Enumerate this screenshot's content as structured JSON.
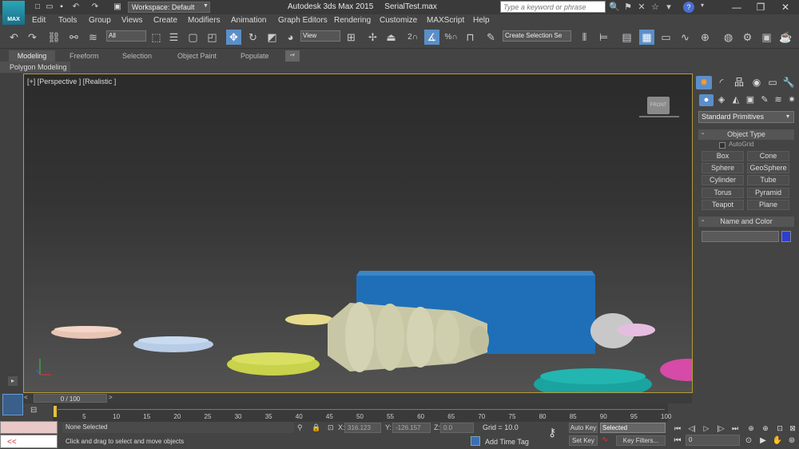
{
  "title": {
    "app": "Autodesk 3ds Max  2015",
    "file": "SerialTest.max",
    "workspace": "Workspace: Default",
    "search_placeholder": "Type a keyword or phrase",
    "logo": "MAX"
  },
  "menu": [
    "Edit",
    "Tools",
    "Group",
    "Views",
    "Create",
    "Modifiers",
    "Animation",
    "Graph Editors",
    "Rendering",
    "Customize",
    "MAXScript",
    "Help"
  ],
  "toolbar": {
    "filter": "All",
    "refcoord": "View",
    "selset": "Create Selection Se",
    "snap_label": "2",
    "angle_label": "%"
  },
  "ribbon": {
    "tabs": [
      "Modeling",
      "Freeform",
      "Selection",
      "Object Paint",
      "Populate"
    ],
    "panel": "Polygon Modeling"
  },
  "viewport": {
    "label": "[+] [Perspective ] [Realistic ]",
    "viewcube": "FRONT"
  },
  "command_panel": {
    "category": "Standard Primitives",
    "object_type_header": "Object Type",
    "autogrid": "AutoGrid",
    "buttons": [
      "Box",
      "Cone",
      "Sphere",
      "GeoSphere",
      "Cylinder",
      "Tube",
      "Torus",
      "Pyramid",
      "Teapot",
      "Plane"
    ],
    "name_color_header": "Name and Color",
    "object_color": "#2c3fcf"
  },
  "timeline": {
    "slider": "0 / 100",
    "ticks": [
      "5",
      "10",
      "15",
      "20",
      "25",
      "30",
      "35",
      "40",
      "45",
      "50",
      "55",
      "60",
      "65",
      "70",
      "75",
      "80",
      "85",
      "90",
      "95",
      "100"
    ]
  },
  "status": {
    "selection": "None Selected",
    "prompt": "Click and drag to select and move objects",
    "x_label": "X:",
    "x": "316.123",
    "y_label": "Y:",
    "y": "-126.157",
    "z_label": "Z:",
    "z": "0.0",
    "grid": "Grid = 10.0",
    "add_time_tag": "Add Time Tag",
    "auto_key": "Auto Key",
    "set_key": "Set Key",
    "key_mode": "Selected",
    "key_filters": "Key Filters...",
    "frame": "0",
    "maxscript_prompt": "<<"
  }
}
